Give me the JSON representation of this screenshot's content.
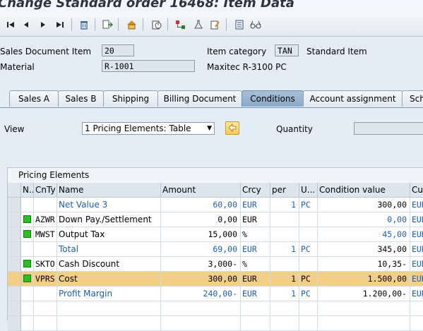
{
  "window": {
    "title": "Change Standard order 16468: Item Data"
  },
  "toolbar": {
    "icons": [
      "first-page-icon",
      "previous-page-icon",
      "next-page-icon",
      "last-page-icon",
      "trash-icon",
      "document-flow-icon",
      "header-icon",
      "status-icon",
      "configure-icon",
      "flask-icon",
      "notes-icon",
      "table-icon",
      "glasses-icon"
    ]
  },
  "header": {
    "sales_doc_item_label": "Sales Document Item",
    "sales_doc_item_value": "20",
    "item_category_label": "Item category",
    "item_category_value": "TAN",
    "item_category_text": "Standard Item",
    "material_label": "Material",
    "material_value": "R-1001",
    "material_text": "Maxitec R-3100 PC"
  },
  "tabs": [
    "Sales A",
    "Sales B",
    "Shipping",
    "Billing Document",
    "Conditions",
    "Account assignment",
    "Sch"
  ],
  "active_tab": "Conditions",
  "view": {
    "label": "View",
    "value": "1 Pricing Elements: Table"
  },
  "quantity": {
    "label": "Quantity",
    "value": ""
  },
  "pricing": {
    "title": "Pricing Elements",
    "columns": [
      "N..",
      "CnTy",
      "Name",
      "Amount",
      "Crcy",
      "per",
      "U...",
      "Condition value",
      "Cur"
    ],
    "rows": [
      {
        "status": "",
        "cnty": "",
        "name": "Net Value 3",
        "amount": "60,00",
        "crcy": "EUR",
        "per": "1",
        "uom": "PC",
        "cond_value": "300,00",
        "cur": "EUR",
        "blue": true,
        "highlight": false
      },
      {
        "status": "green",
        "cnty": "AZWR",
        "name": "Down Pay./Settlement",
        "amount": "0,00",
        "crcy": "EUR",
        "per": "",
        "uom": "",
        "cond_value": "0,00",
        "cur": "EUR",
        "blue": false,
        "highlight": false
      },
      {
        "status": "green",
        "cnty": "MWST",
        "name": "Output Tax",
        "amount": "15,000",
        "crcy": "%",
        "per": "",
        "uom": "",
        "cond_value": "45,00",
        "cur": "EUR",
        "blue": false,
        "highlight": false
      },
      {
        "status": "",
        "cnty": "",
        "name": "Total",
        "amount": "69,00",
        "crcy": "EUR",
        "per": "1",
        "uom": "PC",
        "cond_value": "345,00",
        "cur": "EUR",
        "blue": true,
        "highlight": false
      },
      {
        "status": "green",
        "cnty": "SKTO",
        "name": "Cash Discount",
        "amount": "3,000-",
        "crcy": "%",
        "per": "",
        "uom": "",
        "cond_value": "10,35-",
        "cur": "EUR",
        "blue": false,
        "highlight": false
      },
      {
        "status": "green",
        "cnty": "VPRS",
        "name": "Cost",
        "amount": "300,00",
        "crcy": "EUR",
        "per": "1",
        "uom": "PC",
        "cond_value": "1.500,00",
        "cur": "EUR",
        "blue": false,
        "highlight": true
      },
      {
        "status": "",
        "cnty": "",
        "name": "Profit Margin",
        "amount": "240,00-",
        "crcy": "EUR",
        "per": "1",
        "uom": "PC",
        "cond_value": "1.200,00-",
        "cur": "EUR",
        "blue": true,
        "highlight": false
      }
    ]
  }
}
